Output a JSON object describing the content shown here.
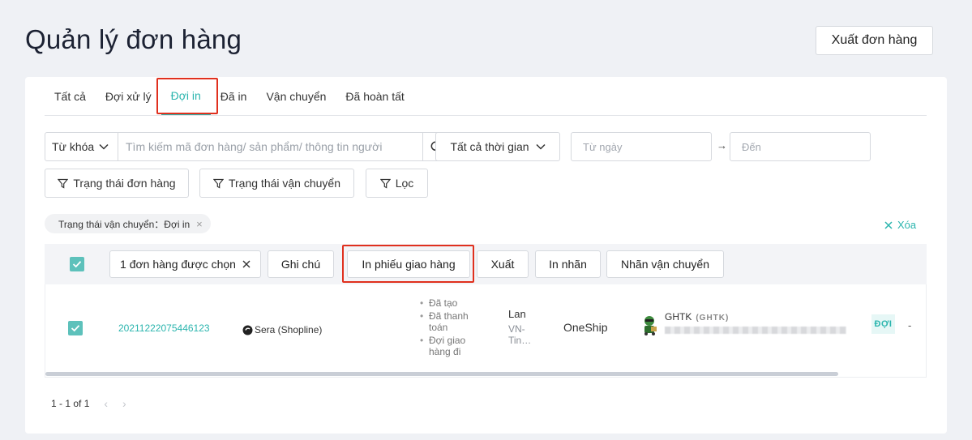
{
  "page": {
    "title": "Quản lý đơn hàng",
    "export_label": "Xuất đơn hàng"
  },
  "tabs": [
    {
      "label": "Tất cả",
      "active": false
    },
    {
      "label": "Đợi xử lý",
      "active": false
    },
    {
      "label": "Đợi in",
      "active": true
    },
    {
      "label": "Đã in",
      "active": false
    },
    {
      "label": "Vận chuyển",
      "active": false
    },
    {
      "label": "Đã hoàn tất",
      "active": false
    }
  ],
  "search": {
    "keyword_select": "Từ khóa",
    "placeholder": "Tìm kiếm mã đơn hàng/ sản phẩm/ thông tin người",
    "time_select": "Tất cả thời gian",
    "from_date_placeholder": "Từ ngày",
    "to_date_placeholder": "Đến",
    "arrow": "→"
  },
  "filters": {
    "order_status": "Trạng thái đơn hàng",
    "shipping_status": "Trạng thái vận chuyển",
    "filter": "Lọc"
  },
  "active_filter": {
    "label": "Trạng thái vận chuyển：Đợi in",
    "clear_label": "Xóa"
  },
  "bulk": {
    "selected_label": "1 đơn hàng được chọn",
    "note": "Ghi chú",
    "print_delivery": "In phiếu giao hàng",
    "export": "Xuất",
    "print_label": "In nhãn",
    "shipping_label": "Nhãn vận chuyển"
  },
  "row": {
    "order_id": "20211222075446123",
    "store": "Sera (Shopline)",
    "statuses": [
      "Đã tạo",
      "Đã thanh toán",
      "Đợi giao hàng đi"
    ],
    "customer_name": "Lan",
    "customer_location": "VN-Tin…",
    "shipper": "OneShip",
    "carrier": "GHTK",
    "carrier_code": "(GHTK)",
    "status_badge": "ĐỢI",
    "dash": "-"
  },
  "pagination": {
    "range": "1 - 1 of 1"
  },
  "colors": {
    "accent": "#2bb5ae",
    "highlight": "#e0301e"
  }
}
